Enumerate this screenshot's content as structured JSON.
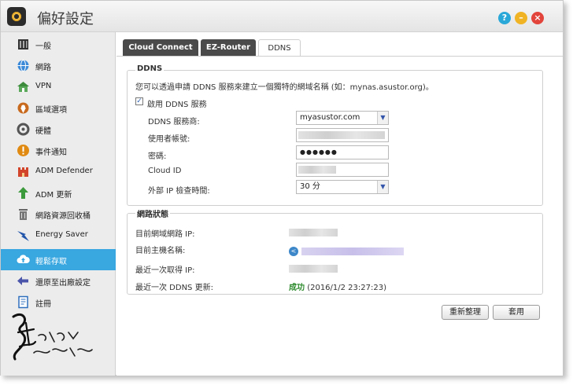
{
  "window": {
    "title": "偏好設定",
    "controls": {
      "help": "?",
      "minimize": "–",
      "close": "×"
    }
  },
  "sidebar": {
    "items": [
      {
        "label": "一般",
        "icon": "general-icon",
        "color": "#333333"
      },
      {
        "label": "網路",
        "icon": "network-globe-icon",
        "color": "#2e7bcf"
      },
      {
        "label": "VPN",
        "icon": "vpn-icon",
        "color": "#3c8a3c"
      },
      {
        "label": "區域選項",
        "icon": "regional-icon",
        "color": "#c86a1e"
      },
      {
        "label": "硬體",
        "icon": "hardware-icon",
        "color": "#555555"
      },
      {
        "label": "事件通知",
        "icon": "notification-icon",
        "color": "#e08a12"
      },
      {
        "label": "ADM Defender",
        "icon": "defender-icon",
        "color": "#d2452a"
      },
      {
        "label": "ADM 更新",
        "icon": "update-arrow-icon",
        "color": "#3c9a3c"
      },
      {
        "label": "網路資源回收桶",
        "icon": "recycle-bin-icon",
        "color": "#666666"
      },
      {
        "label": "Energy Saver",
        "icon": "energy-saver-icon",
        "color": "#2255aa"
      },
      {
        "label": "輕鬆存取",
        "icon": "cloud-access-icon",
        "color": "#ffffff",
        "active": true
      },
      {
        "label": "還原至出廠設定",
        "icon": "restore-icon",
        "color": "#4a55aa"
      },
      {
        "label": "註冊",
        "icon": "register-icon",
        "color": "#2e6fbd"
      }
    ]
  },
  "tabs": [
    {
      "label": "Cloud Connect"
    },
    {
      "label": "EZ-Router"
    },
    {
      "label": "DDNS",
      "active": true
    }
  ],
  "ddns": {
    "legend": "DDNS",
    "description": "您可以透過申請 DDNS 服務來建立一個獨特的網域名稱 (如：mynas.asustor.org)。",
    "enable_label": "啟用 DDNS 服務",
    "enable_checked": "✓",
    "fields": {
      "provider_label": "DDNS 服務商:",
      "provider_value": "myasustor.com",
      "username_label": "使用者帳號:",
      "password_label": "密碼:",
      "password_value": "●●●●●●",
      "cloud_id_label": "Cloud ID",
      "check_interval_label": "外部 IP 檢查時間:",
      "check_interval_value": "30 分"
    }
  },
  "network_status": {
    "legend": "網路狀態",
    "current_ip_label": "目前網域網路 IP:",
    "current_host_label": "目前主機名稱:",
    "last_ip_label": "最近一次取得 IP:",
    "last_update_label": "最近一次 DDNS 更新:",
    "last_update_status": "成功",
    "last_update_time": "(2016/1/2 23:27:23)"
  },
  "buttons": {
    "reset": "重新整理",
    "apply": "套用"
  },
  "watermark": {
    "text": "小鳥の部落格"
  }
}
